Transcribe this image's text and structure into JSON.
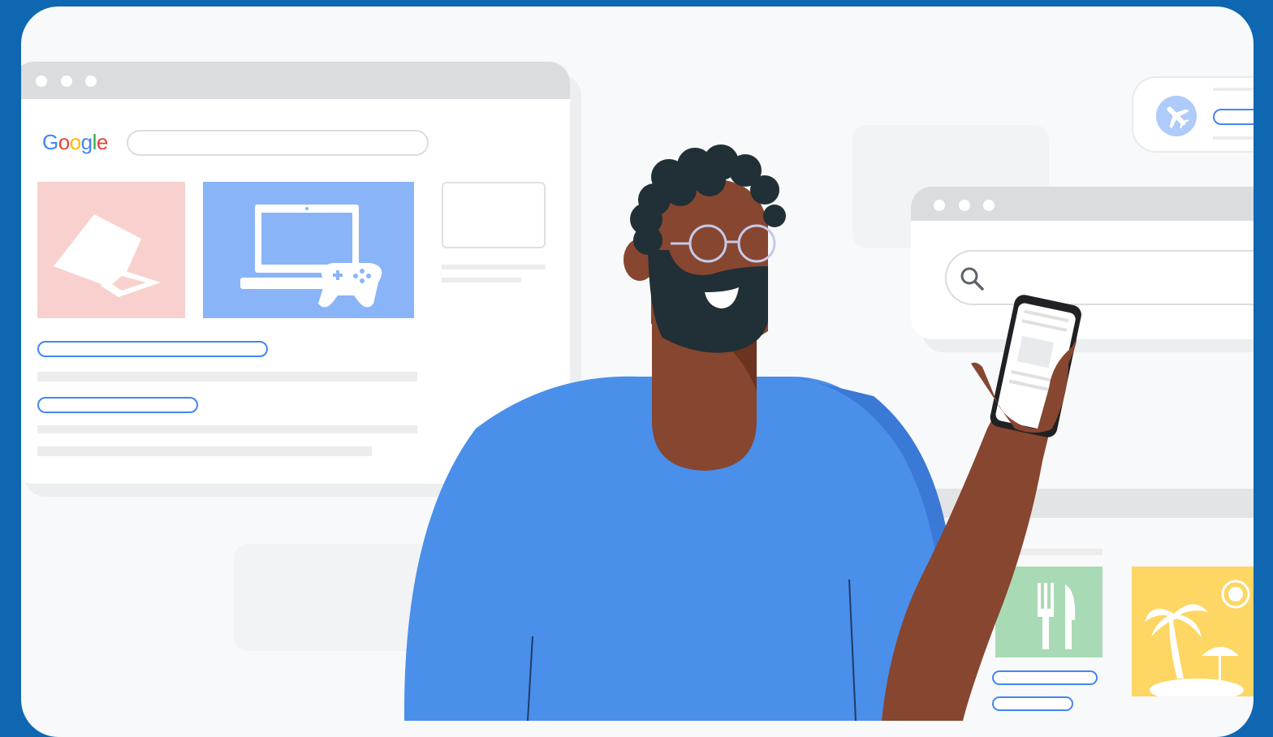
{
  "brand": {
    "logo_letters": [
      "G",
      "o",
      "o",
      "g",
      "l",
      "e"
    ],
    "logo_colors": [
      "#4285f4",
      "#ea4335",
      "#fbbc04",
      "#4285f4",
      "#34a853",
      "#ea4335"
    ]
  },
  "colors": {
    "frame": "#0f67b1",
    "card": "#f8f9fa",
    "window_bar": "#dadce0",
    "accent_blue": "#4285f4",
    "shirt": "#4a8fea",
    "skin": "#874630",
    "hair": "#212f36",
    "tile_pink": "#f8d1ce",
    "tile_blue": "#8ab4f8",
    "tile_green": "#a8dab5",
    "tile_yellow": "#fdd663"
  },
  "icons": {
    "laptop_closed": "laptop-icon",
    "laptop_open": "laptop-open-icon",
    "gamepad": "gamepad-icon",
    "search": "search-icon",
    "airplane": "airplane-icon",
    "cutlery": "fork-knife-icon",
    "palm": "palm-tree-icon",
    "sun": "sun-icon"
  }
}
